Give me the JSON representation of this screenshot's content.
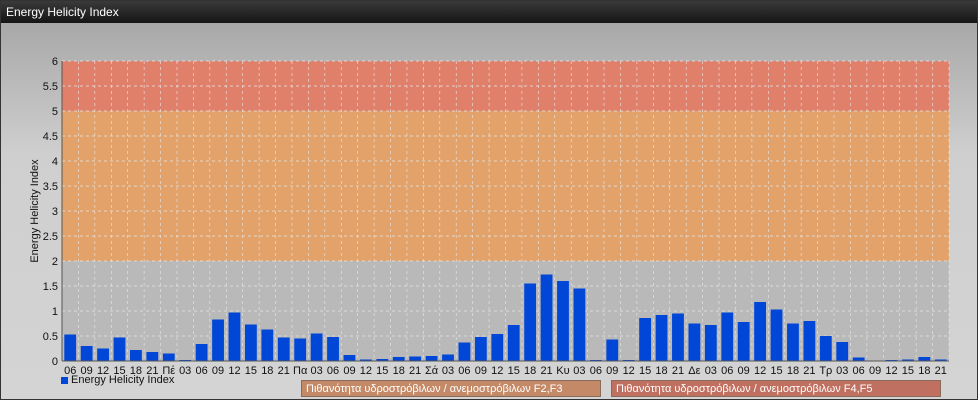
{
  "window": {
    "title": "Energy Helicity Index"
  },
  "legend": {
    "series_label": "Energy Helicity Index"
  },
  "bands": [
    {
      "label": "Πιθανότητα υδροστρόβιλων / ανεμοστρόβιλων F2,F3",
      "from": 2,
      "to": 5,
      "color": "#e8a060"
    },
    {
      "label": "Πιθανότητα υδροστρόβιλων / ανεμοστρόβιλων F4,F5",
      "from": 5,
      "to": 6,
      "color": "#e57a62"
    }
  ],
  "chart_data": {
    "type": "bar",
    "ylabel": "Energy Helicity Index",
    "ylim": [
      0,
      6
    ],
    "yticks": [
      "0",
      "0.5",
      "1",
      "1.5",
      "2",
      "2.5",
      "3",
      "3.5",
      "4",
      "4.5",
      "5",
      "5.5",
      "6"
    ],
    "grid": true,
    "legend_placement": "bottom-left",
    "bar_color": "#0047d8",
    "categories": [
      "06",
      "09",
      "12",
      "15",
      "18",
      "21",
      "Πέ",
      "03",
      "06",
      "09",
      "12",
      "15",
      "18",
      "21",
      "Πα",
      "03",
      "06",
      "09",
      "12",
      "15",
      "18",
      "21",
      "Σά",
      "03",
      "06",
      "09",
      "12",
      "15",
      "18",
      "21",
      "Κυ",
      "03",
      "06",
      "09",
      "12",
      "15",
      "18",
      "21",
      "Δε",
      "03",
      "06",
      "09",
      "12",
      "15",
      "18",
      "21",
      "Τρ",
      "03",
      "06",
      "09",
      "12",
      "15",
      "18",
      "21"
    ],
    "values": [
      0.53,
      0.3,
      0.25,
      0.47,
      0.22,
      0.18,
      0.15,
      0.02,
      0.34,
      0.83,
      0.97,
      0.73,
      0.63,
      0.47,
      0.45,
      0.55,
      0.48,
      0.12,
      0.03,
      0.04,
      0.08,
      0.09,
      0.1,
      0.13,
      0.37,
      0.48,
      0.54,
      0.72,
      1.55,
      1.73,
      1.6,
      1.45,
      0.02,
      0.43,
      0.02,
      0.86,
      0.92,
      0.95,
      0.75,
      0.72,
      0.97,
      0.78,
      1.18,
      1.03,
      0.75,
      0.8,
      0.5,
      0.38,
      0.07,
      0.01,
      0.02,
      0.03,
      0.08,
      0.03
    ]
  }
}
